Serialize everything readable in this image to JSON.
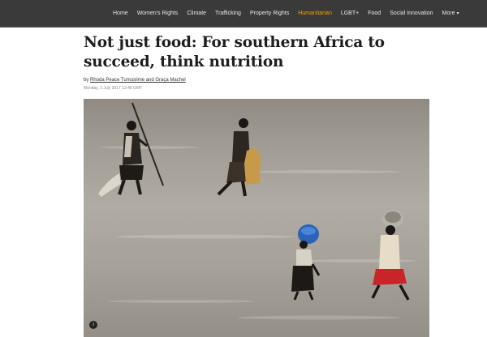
{
  "nav": {
    "items": [
      {
        "label": "Home"
      },
      {
        "label": "Women's Rights"
      },
      {
        "label": "Climate"
      },
      {
        "label": "Trafficking"
      },
      {
        "label": "Property Rights"
      },
      {
        "label": "Humanitarian",
        "active": true
      },
      {
        "label": "LGBT+"
      },
      {
        "label": "Food"
      },
      {
        "label": "Social Innovation"
      },
      {
        "label": "More"
      }
    ],
    "active_color": "#f5a300"
  },
  "article": {
    "title": "Not just food: For southern Africa to succeed, think nutrition",
    "byline_prefix": "by",
    "authors": "Rhoda Peace Tumusiime and Graça Machel",
    "date": "Monday, 3 July 2017 12:48 GMT",
    "image_badge": "i"
  }
}
